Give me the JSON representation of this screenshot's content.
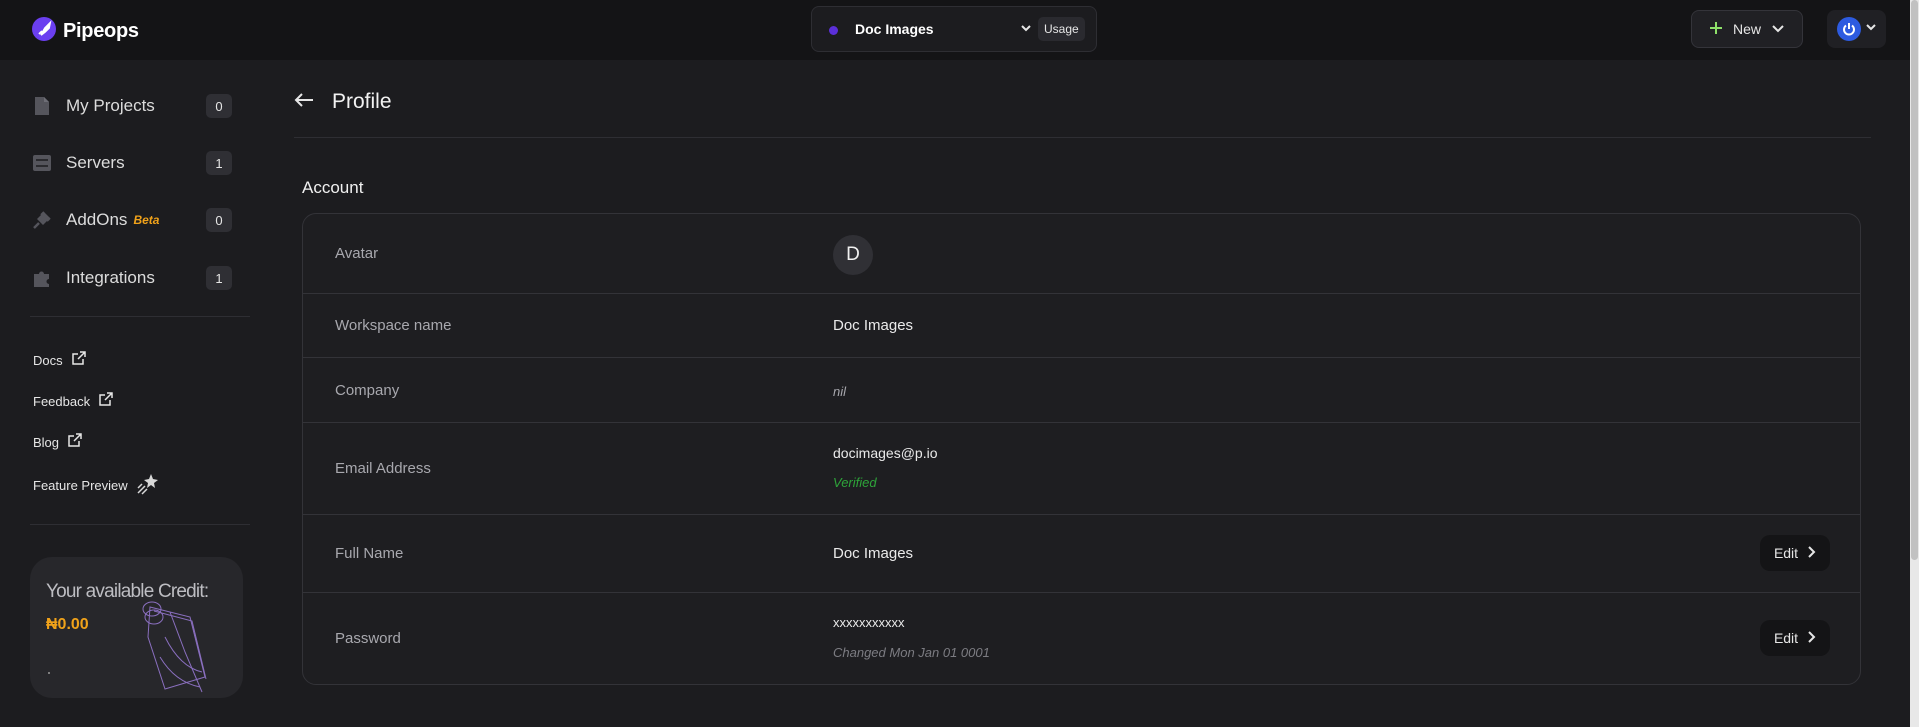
{
  "app": {
    "name": "Pipeops"
  },
  "workspace": {
    "name": "Doc Images",
    "usage_label": "Usage",
    "dot_color": "#5b2fd9"
  },
  "header": {
    "new_label": "New"
  },
  "sidebar": {
    "items": [
      {
        "label": "My Projects",
        "count": "0",
        "icon": "file-icon"
      },
      {
        "label": "Servers",
        "count": "1",
        "icon": "server-icon"
      },
      {
        "label": "AddOns",
        "badge": "Beta",
        "count": "0",
        "icon": "plug-icon"
      },
      {
        "label": "Integrations",
        "count": "1",
        "icon": "puzzle-icon"
      }
    ],
    "links": [
      {
        "label": "Docs",
        "icon": "external-link-icon"
      },
      {
        "label": "Feedback",
        "icon": "external-link-icon"
      },
      {
        "label": "Blog",
        "icon": "external-link-icon"
      },
      {
        "label": "Feature Preview",
        "icon": "sparkle-star-icon"
      }
    ],
    "credit": {
      "title": "Your available Credit:",
      "amount": "₦0.00"
    }
  },
  "page": {
    "title": "Profile",
    "section": "Account"
  },
  "profile": {
    "avatar": {
      "label": "Avatar",
      "initial": "D"
    },
    "workspace_name": {
      "label": "Workspace name",
      "value": "Doc Images"
    },
    "company": {
      "label": "Company",
      "value": "nil"
    },
    "email": {
      "label": "Email Address",
      "value": "docimages@p.io",
      "status": "Verified"
    },
    "full_name": {
      "label": "Full Name",
      "value": "Doc Images",
      "edit_label": "Edit"
    },
    "password": {
      "label": "Password",
      "value": "xxxxxxxxxxx",
      "changed": "Changed Mon Jan 01 0001",
      "edit_label": "Edit"
    }
  },
  "colors": {
    "accent": "#f0a21a",
    "verified": "#2ea43a",
    "user_avatar": "#2d5be0"
  }
}
